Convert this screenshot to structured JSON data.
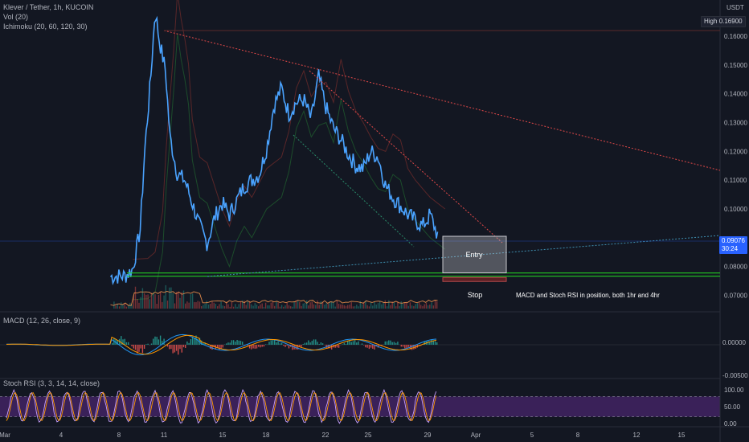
{
  "header": {
    "symbol_title": "Klever / Tether, 1h, KUCOIN",
    "currency": "USDT"
  },
  "legends": {
    "volume": "Vol (20)",
    "ichimoku": "Ichimoku (20, 60, 120, 30)",
    "macd": "MACD (12, 26, close, 9)",
    "stoch": "Stoch RSI (3, 3, 14, 14, close)"
  },
  "price_tags": {
    "high_label": "High",
    "high_value": "0.16900",
    "last_price": "0.09076",
    "countdown": "30:24"
  },
  "annotations": {
    "entry": "Entry",
    "stop": "Stop",
    "note": "MACD and Stoch RSI in position, both 1hr and 4hr"
  },
  "colors": {
    "background": "#131722",
    "price_line": "#4aa3ff",
    "support_line": "#22cc22",
    "trend_line": "#e04848",
    "last_price_tag": "#2962ff",
    "stoch_band": "#5b2a86",
    "macd_up": "#26a69a",
    "macd_down": "#ef5350"
  },
  "chart_data": {
    "type": "line",
    "price_axis": {
      "ticks": [
        "0.16000",
        "0.15000",
        "0.14000",
        "0.13000",
        "0.12000",
        "0.11000",
        "0.10000",
        "0.08000",
        "0.07000"
      ],
      "range": [
        0.0665,
        0.172
      ]
    },
    "macd_axis": {
      "ticks": [
        "0.00000",
        "-0.00500"
      ]
    },
    "stoch_axis": {
      "ticks": [
        "100.00",
        "50.00",
        "0.00"
      ],
      "band": [
        20,
        80
      ]
    },
    "x_ticks": [
      "Mar",
      "4",
      "8",
      "11",
      "15",
      "18",
      "22",
      "25",
      "29",
      "Apr",
      "5",
      "8",
      "12",
      "15"
    ],
    "price_series": {
      "x": [
        "Mar 8",
        "Mar 9",
        "Mar 9.5",
        "Mar 10",
        "Mar 10.3",
        "Mar 10.7",
        "Mar 11",
        "Mar 11.3",
        "Mar 11.7",
        "Mar 12",
        "Mar 12.5",
        "Mar 13",
        "Mar 13.5",
        "Mar 14",
        "Mar 14.5",
        "Mar 15",
        "Mar 15.5",
        "Mar 16",
        "Mar 16.5",
        "Mar 17",
        "Mar 17.5",
        "Mar 18",
        "Mar 18.5",
        "Mar 19",
        "Mar 19.5",
        "Mar 20",
        "Mar 20.5",
        "Mar 21",
        "Mar 21.5",
        "Mar 22",
        "Mar 22.5",
        "Mar 23",
        "Mar 23.5",
        "Mar 24",
        "Mar 24.5",
        "Mar 25",
        "Mar 25.5",
        "Mar 26",
        "Mar 26.5",
        "Mar 27",
        "Mar 27.5",
        "Mar 28",
        "Mar 28.5",
        "Mar 29",
        "Mar 29.5",
        "Mar 30"
      ],
      "values": [
        0.0765,
        0.0768,
        0.079,
        0.093,
        0.12,
        0.145,
        0.169,
        0.158,
        0.148,
        0.125,
        0.112,
        0.11,
        0.102,
        0.094,
        0.088,
        0.097,
        0.102,
        0.098,
        0.103,
        0.108,
        0.11,
        0.112,
        0.121,
        0.136,
        0.142,
        0.133,
        0.137,
        0.138,
        0.131,
        0.146,
        0.135,
        0.128,
        0.124,
        0.119,
        0.115,
        0.114,
        0.12,
        0.118,
        0.108,
        0.104,
        0.101,
        0.098,
        0.096,
        0.094,
        0.098,
        0.0908
      ]
    },
    "support_level": 0.0772,
    "entry_zone": [
      0.0778,
      0.0905
    ],
    "stop_zone": [
      0.0753,
      0.0762
    ],
    "grid": false
  }
}
